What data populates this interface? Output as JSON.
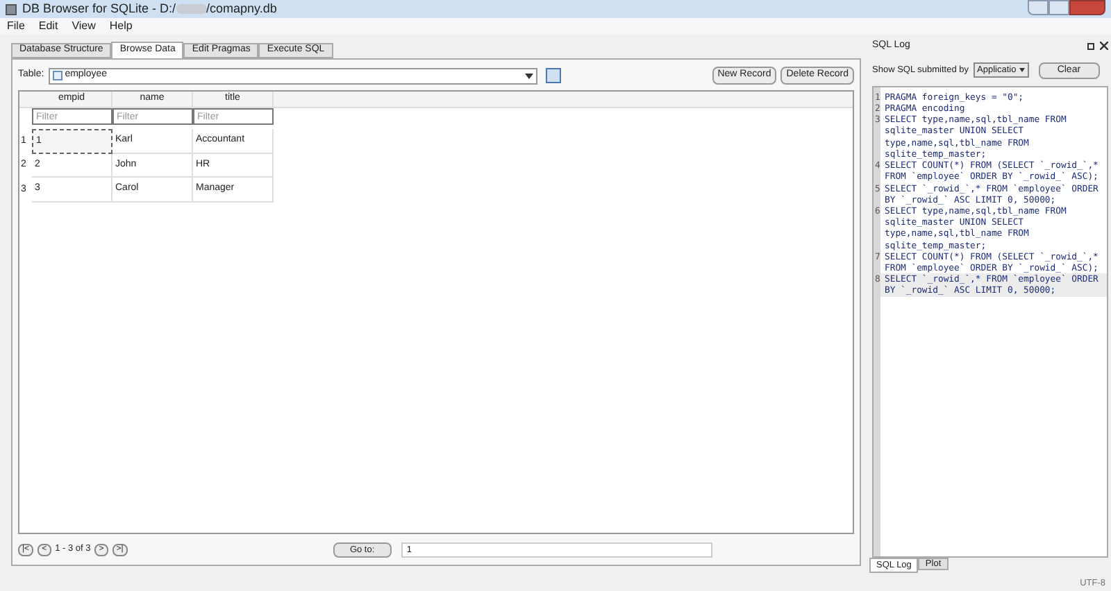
{
  "window": {
    "title_prefix": "DB Browser for SQLite - D:/",
    "title_file": "/comapny.db"
  },
  "menu": [
    "File",
    "Edit",
    "View",
    "Help"
  ],
  "tabs": [
    {
      "label": "Database Structure",
      "selected": false
    },
    {
      "label": "Browse Data",
      "selected": true
    },
    {
      "label": "Edit Pragmas",
      "selected": false
    },
    {
      "label": "Execute SQL",
      "selected": false
    }
  ],
  "table_picker": {
    "label": "Table:",
    "value": "employee"
  },
  "buttons": [
    "New Record",
    "Delete Record"
  ],
  "grid": {
    "columns": [
      "empid",
      "name",
      "title"
    ],
    "filter_placeholders": [
      "Filter",
      "Filter",
      "Filter"
    ],
    "rows": [
      {
        "number": "1",
        "cells": [
          "1",
          "Karl",
          "Accountant"
        ],
        "focused": true
      },
      {
        "number": "2",
        "cells": [
          "2",
          "John",
          "HR"
        ],
        "focused": false
      },
      {
        "number": "3",
        "cells": [
          "3",
          "Carol",
          "Manager"
        ],
        "focused": false
      }
    ]
  },
  "pager": {
    "first": "|<",
    "prev": "<",
    "range": "1 - 3 of 3",
    "next": ">",
    "last": ">|",
    "goto_label": "Go to:",
    "goto_value": "1"
  },
  "sql_log": {
    "title": "SQL Log",
    "filter_label": "Show SQL submitted by",
    "filter_value": "Applicatio",
    "clear": "Clear",
    "lines": [
      {
        "number": "1",
        "text": "PRAGMA foreign_keys = \"0\";",
        "highlighted": false
      },
      {
        "number": "2",
        "text": "PRAGMA encoding",
        "highlighted": false
      },
      {
        "number": "3",
        "text": "SELECT type,name,sql,tbl_name FROM sqlite_master UNION SELECT type,name,sql,tbl_name FROM sqlite_temp_master;",
        "highlighted": false
      },
      {
        "number": "4",
        "text": "SELECT COUNT(*) FROM (SELECT `_rowid_`,* FROM `employee`  ORDER BY `_rowid_` ASC);",
        "highlighted": false
      },
      {
        "number": "5",
        "text": "SELECT `_rowid_`,* FROM `employee` ORDER BY `_rowid_` ASC LIMIT 0, 50000;",
        "highlighted": false
      },
      {
        "number": "6",
        "text": "SELECT type,name,sql,tbl_name FROM sqlite_master UNION SELECT type,name,sql,tbl_name FROM sqlite_temp_master;",
        "highlighted": false
      },
      {
        "number": "7",
        "text": "SELECT COUNT(*) FROM (SELECT `_rowid_`,* FROM `employee`  ORDER BY `_rowid_` ASC);",
        "highlighted": false
      },
      {
        "number": "8",
        "text": "SELECT `_rowid_`,* FROM `employee` ORDER BY `_rowid_` ASC LIMIT 0, 50000;",
        "highlighted": true
      }
    ]
  },
  "dock_tabs": [
    {
      "label": "SQL Log",
      "selected": true
    },
    {
      "label": "Plot",
      "selected": false
    }
  ],
  "status_bar": {
    "encoding": "UTF-8"
  }
}
